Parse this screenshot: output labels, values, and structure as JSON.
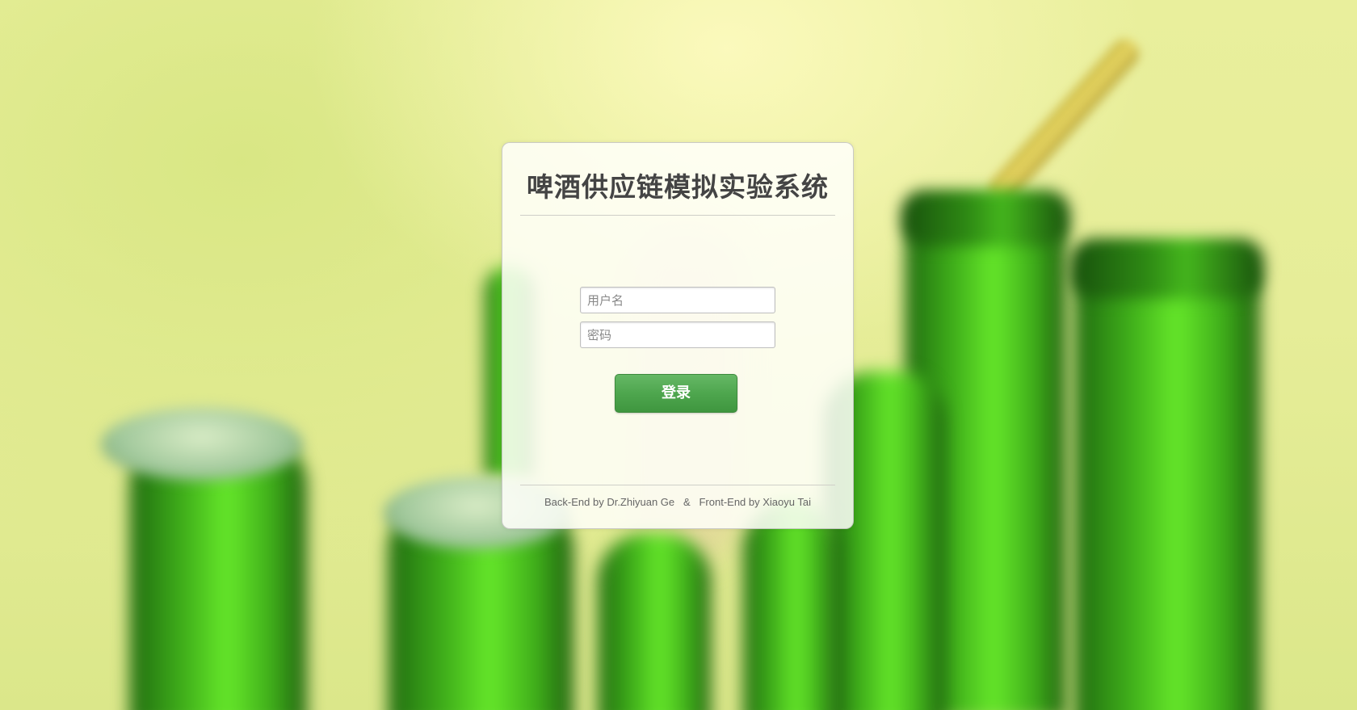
{
  "login": {
    "title": "啤酒供应链模拟实验系统",
    "username_placeholder": "用户名",
    "password_placeholder": "密码",
    "username_value": "",
    "password_value": "",
    "login_label": "登录"
  },
  "footer": {
    "credits": "Back-End by Dr.Zhiyuan Ge   &   Front-End by Xiaoyu Tai"
  },
  "colors": {
    "button": "#4ea64e",
    "title": "#444444",
    "background": "#e6ed98",
    "bottle_green": "#3fae1a"
  }
}
